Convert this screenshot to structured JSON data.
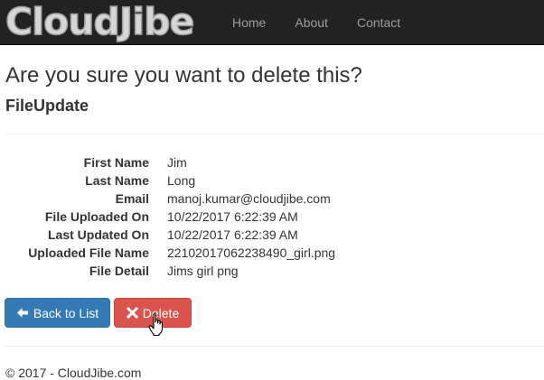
{
  "navbar": {
    "brand": "CloudJibe",
    "links": [
      "Home",
      "About",
      "Contact"
    ],
    "bg_color": "#222222"
  },
  "page": {
    "heading": "Are you sure you want to delete this?",
    "subheading": "FileUpdate"
  },
  "details": [
    {
      "label": "First Name",
      "value": "Jim"
    },
    {
      "label": "Last Name",
      "value": "Long"
    },
    {
      "label": "Email",
      "value": "manoj.kumar@cloudjibe.com"
    },
    {
      "label": "File Uploaded On",
      "value": "10/22/2017 6:22:39 AM"
    },
    {
      "label": "Last Updated On",
      "value": "10/22/2017 6:22:39 AM"
    },
    {
      "label": "Uploaded File Name",
      "value": "22102017062238490_girl.png"
    },
    {
      "label": "File Detail",
      "value": "Jims girl png"
    }
  ],
  "actions": {
    "back_label": "Back to List",
    "back_icon": "arrow-left-icon",
    "back_color": "#337ab7",
    "delete_label": "Delete",
    "delete_icon": "remove-icon",
    "delete_color": "#d9534f"
  },
  "footer": {
    "copyright": "© 2017 - CloudJibe.com"
  }
}
